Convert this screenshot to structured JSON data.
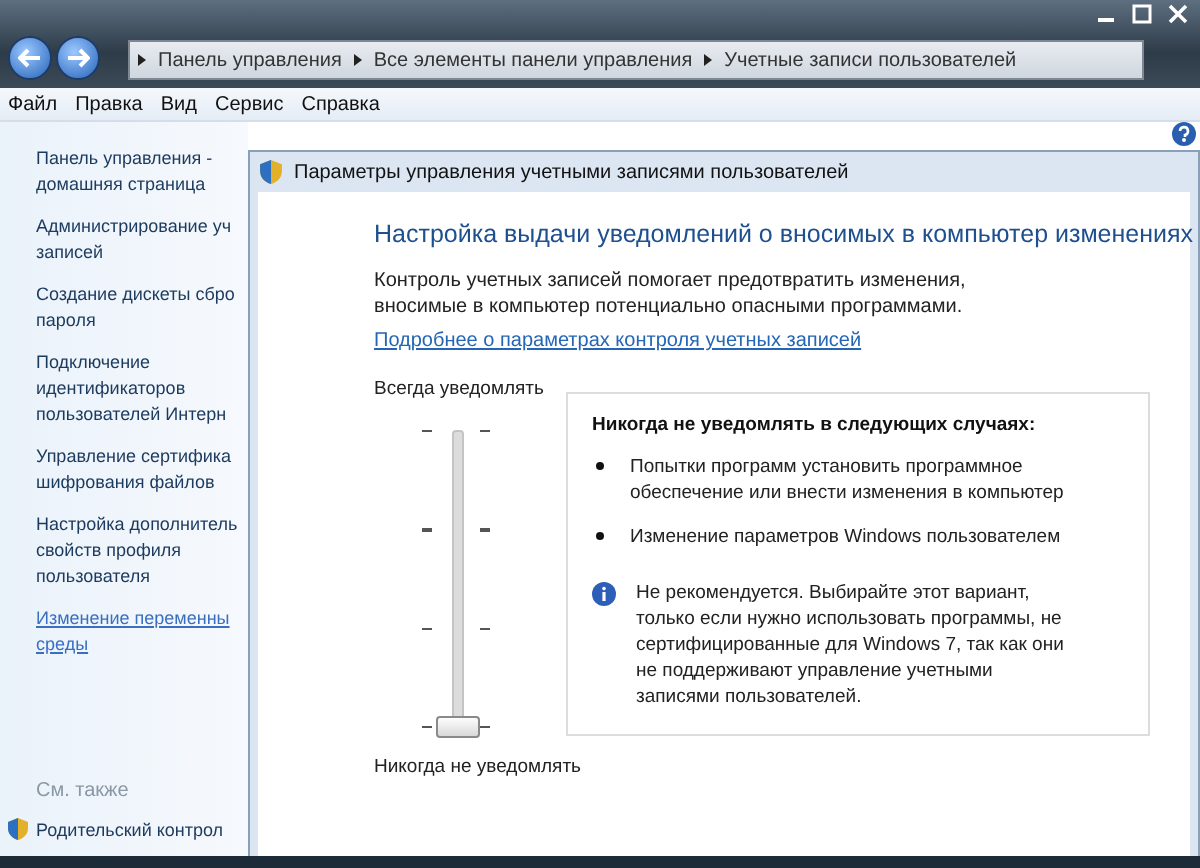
{
  "window": {
    "breadcrumbs": [
      "Панель управления",
      "Все элементы панели управления",
      "Учетные записи пользователей"
    ]
  },
  "menu": [
    "Файл",
    "Правка",
    "Вид",
    "Сервис",
    "Справка"
  ],
  "sidebar": {
    "items": [
      {
        "lines": [
          "Панель управления -",
          "домашняя страница"
        ],
        "hovered": false
      },
      {
        "lines": [
          "Администрирование уч",
          "записей"
        ],
        "hovered": false
      },
      {
        "lines": [
          "Создание дискеты сбро",
          "пароля"
        ],
        "hovered": false
      },
      {
        "lines": [
          "Подключение",
          "идентификаторов",
          "пользователей Интерн"
        ],
        "hovered": false
      },
      {
        "lines": [
          "Управление сертифика",
          "шифрования файлов"
        ],
        "hovered": false
      },
      {
        "lines": [
          "Настройка дополнитель",
          "свойств профиля",
          "пользователя"
        ],
        "hovered": false
      },
      {
        "lines": [
          "Изменение переменны",
          "среды"
        ],
        "hovered": true
      }
    ],
    "see_also": "См. также",
    "parental": "Родительский контрол"
  },
  "dialog": {
    "title": "Параметры управления учетными записями пользователей",
    "heading": "Настройка выдачи уведомлений о вносимых в компьютер изменениях",
    "description": "Контроль учетных записей помогает предотвратить изменения, вносимые в компьютер потенциально опасными программами.",
    "link": "Подробнее о параметрах контроля учетных записей",
    "slider": {
      "top_label": "Всегда уведомлять",
      "bottom_label": "Никогда не уведомлять",
      "level": 0
    },
    "info": {
      "heading": "Никогда не уведомлять в следующих случаях:",
      "bullets": [
        "Попытки программ установить программное обеспечение или внести изменения в компьютер",
        "Изменение параметров Windows пользователем"
      ],
      "note": "Не рекомендуется. Выбирайте этот вариант, только если нужно использовать программы, не сертифицированные для Windows 7, так как они не поддерживают управление учетными записями пользователей."
    }
  }
}
